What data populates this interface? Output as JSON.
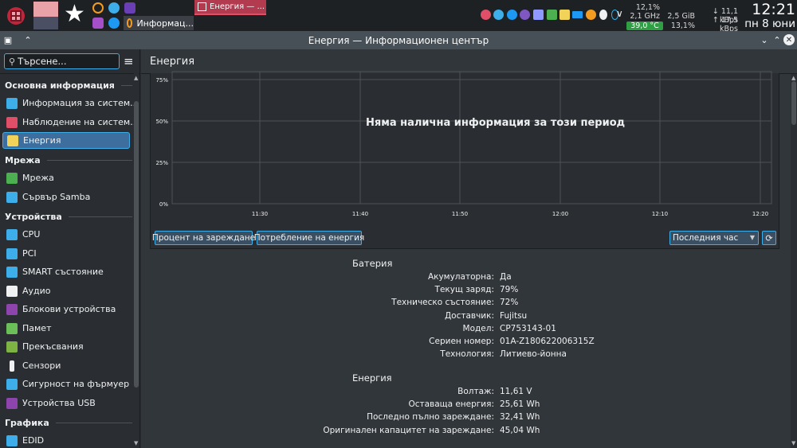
{
  "taskbar": {
    "task_energy_label": "Енергия — ...",
    "task_info_label": "Информац...",
    "cpu_percent": "12,1%",
    "cpu_freq": "2,1 GHz",
    "cpu_temp": "39,0 °C",
    "mem_used": "2,5 GiB",
    "mem_percent": "13,1%",
    "net_down": "↓ 11,1 kBps",
    "net_up": "↑ 17,5 kBps",
    "clock_time": "12:21",
    "clock_date": "пн 8 юни"
  },
  "window": {
    "title": "Енергия — Информационен център"
  },
  "sidebar": {
    "search_placeholder": "Търсене...",
    "sections": [
      {
        "title": "Основна информация"
      },
      {
        "title": "Мрежа"
      },
      {
        "title": "Устройства"
      },
      {
        "title": "Графика"
      }
    ],
    "items": [
      {
        "label": "Информация за систем...",
        "icon": "system-info-icon",
        "color": "#3daee9"
      },
      {
        "label": "Наблюдение на систем...",
        "icon": "system-monitor-icon",
        "color": "#e04f67"
      },
      {
        "label": "Енергия",
        "icon": "battery-icon",
        "color": "#f2d35a"
      },
      {
        "label": "Мрежа",
        "icon": "network-card-icon",
        "color": "#4caf50"
      },
      {
        "label": "Сървър Samba",
        "icon": "share-icon",
        "color": "#3daee9"
      },
      {
        "label": "CPU",
        "icon": "cpu-icon",
        "color": "#3daee9"
      },
      {
        "label": "PCI",
        "icon": "pci-icon",
        "color": "#3daee9"
      },
      {
        "label": "SMART състояние",
        "icon": "smart-status-icon",
        "color": "#3daee9"
      },
      {
        "label": "Аудио",
        "icon": "audio-icon",
        "color": "#eff0f1"
      },
      {
        "label": "Блокови устройства",
        "icon": "block-devices-icon",
        "color": "#8e44ad"
      },
      {
        "label": "Памет",
        "icon": "memory-icon",
        "color": "#6bbf59"
      },
      {
        "label": "Прекъсвания",
        "icon": "interrupts-icon",
        "color": "#7cb342"
      },
      {
        "label": "Сензори",
        "icon": "thermometer-icon",
        "color": "#eff0f1"
      },
      {
        "label": "Сигурност на фърмуер",
        "icon": "firmware-security-icon",
        "color": "#3daee9"
      },
      {
        "label": "Устройства USB",
        "icon": "usb-icon",
        "color": "#8e44ad"
      },
      {
        "label": "EDID",
        "icon": "monitor-icon",
        "color": "#3daee9"
      }
    ]
  },
  "main": {
    "page_title": "Енергия",
    "no_data_text": "Няма налична информация за този период",
    "tab_charge": "Процент на зареждане",
    "tab_consumption": "Потребление на енергия",
    "period_select": "Последния час",
    "battery": {
      "title": "Батерия",
      "rows": [
        {
          "key": "Акумулаторна:",
          "value": "Да"
        },
        {
          "key": "Текущ заряд:",
          "value": "79%"
        },
        {
          "key": "Техническо състояние:",
          "value": "72%"
        },
        {
          "key": "Доставчик:",
          "value": "Fujitsu"
        },
        {
          "key": "Модел:",
          "value": "CP753143-01"
        },
        {
          "key": "Сериен номер:",
          "value": "01A-Z180622006315Z"
        },
        {
          "key": "Технология:",
          "value": "Литиево-йонна"
        }
      ]
    },
    "energy": {
      "title": "Енергия",
      "rows": [
        {
          "key": "Волтаж:",
          "value": "11,61 V"
        },
        {
          "key": "Оставаща енергия:",
          "value": "25,61 Wh"
        },
        {
          "key": "Последно пълно зареждане:",
          "value": "32,41 Wh"
        },
        {
          "key": "Оригинален капацитет на зареждане:",
          "value": "45,04 Wh"
        }
      ]
    }
  },
  "chart_data": {
    "type": "line",
    "y_ticks": [
      "75%",
      "50%",
      "25%",
      "0%"
    ],
    "x_ticks": [
      "11:30",
      "11:40",
      "11:50",
      "12:00",
      "12:10",
      "12:20"
    ],
    "series": [],
    "grid": true
  }
}
